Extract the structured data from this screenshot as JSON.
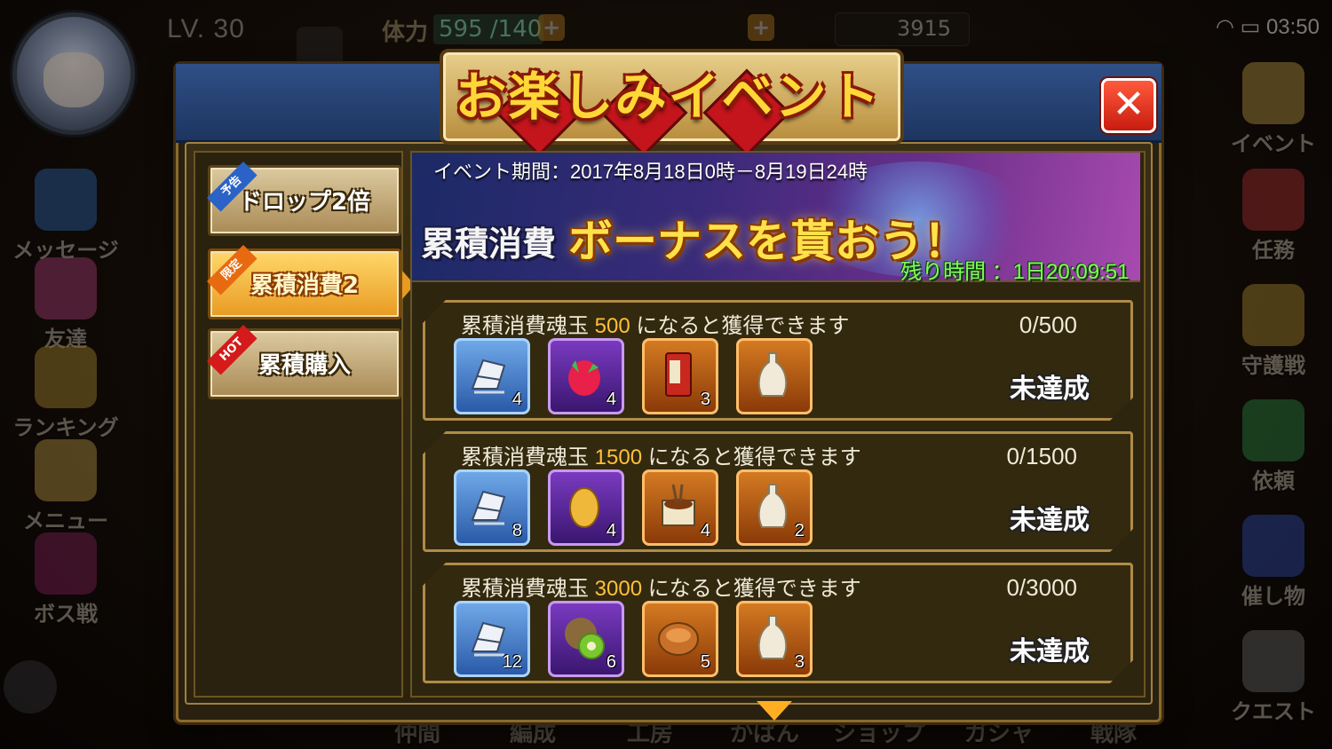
{
  "hud": {
    "level": "LV. 30",
    "stamina_label": "体力",
    "stamina_value": "595 /140",
    "currency_value": "3915",
    "clock": "03:50"
  },
  "left_nav": [
    {
      "label": "メッセージ",
      "icon": "envelope-icon"
    },
    {
      "label": "友達",
      "icon": "crane-icon"
    },
    {
      "label": "ランキング",
      "icon": "trophy-icon"
    },
    {
      "label": "メニュー",
      "icon": "menu-face-icon"
    },
    {
      "label": "ボス戦",
      "icon": "boss-icon"
    }
  ],
  "right_nav": [
    {
      "label": "イベント",
      "icon": "lucky-cat-icon"
    },
    {
      "label": "任務",
      "icon": "mission-icon"
    },
    {
      "label": "守護戦",
      "icon": "charm-icon"
    },
    {
      "label": "依頼",
      "icon": "scroll-icon"
    },
    {
      "label": "催し物",
      "icon": "book-icon"
    },
    {
      "label": "クエスト",
      "icon": "scooter-icon"
    }
  ],
  "bottom_tabs": [
    "仲間",
    "編成",
    "工房",
    "かばん",
    "ショップ",
    "ガシャ",
    "戦隊"
  ],
  "modal": {
    "title": "お楽しみイベント",
    "close_symbol": "✕"
  },
  "tabs": [
    {
      "label": "ドロップ2倍",
      "ribbon": "予告",
      "ribbon_color": "#2a62c8",
      "active": false
    },
    {
      "label": "累積消費2",
      "ribbon": "限定",
      "ribbon_color": "#e86a10",
      "active": true
    },
    {
      "label": "累積購入",
      "ribbon": "HOT",
      "ribbon_color": "#d41a1a",
      "active": false
    }
  ],
  "banner": {
    "period": "イベント期間：2017年8月18日0時－8月19日24時",
    "tag": "累積消費",
    "headline": "ボーナスを貰おう！",
    "remaining": "残り時間 ：1日20:09:51"
  },
  "rewards": [
    {
      "text_prefix": "累積消費魂玉 ",
      "amount": "500",
      "text_suffix": " になると獲得できます",
      "progress": "0/500",
      "status": "未達成",
      "items": [
        {
          "icon": "lounge-chair-icon",
          "frame": "blue",
          "count": "4"
        },
        {
          "icon": "dragon-fruit-icon",
          "frame": "purple",
          "count": "4"
        },
        {
          "icon": "vinegar-kelp-icon",
          "frame": "orange",
          "count": "3"
        },
        {
          "icon": "sake-bottle-icon",
          "frame": "orange",
          "count": ""
        }
      ]
    },
    {
      "text_prefix": "累積消費魂玉 ",
      "amount": "1500",
      "text_suffix": " になると獲得できます",
      "progress": "0/1500",
      "status": "未達成",
      "items": [
        {
          "icon": "lounge-chair-icon",
          "frame": "blue",
          "count": "8"
        },
        {
          "icon": "mango-icon",
          "frame": "purple",
          "count": "4"
        },
        {
          "icon": "natto-icon",
          "frame": "orange",
          "count": "4"
        },
        {
          "icon": "sake-bottle-icon",
          "frame": "orange",
          "count": "2"
        }
      ]
    },
    {
      "text_prefix": "累積消費魂玉 ",
      "amount": "3000",
      "text_suffix": " になると獲得できます",
      "progress": "0/3000",
      "status": "未達成",
      "items": [
        {
          "icon": "lounge-chair-icon",
          "frame": "blue",
          "count": "12"
        },
        {
          "icon": "kiwi-icon",
          "frame": "purple",
          "count": "6"
        },
        {
          "icon": "anpan-icon",
          "frame": "orange",
          "count": "5"
        },
        {
          "icon": "sake-bottle-icon",
          "frame": "orange",
          "count": "3"
        }
      ]
    }
  ]
}
